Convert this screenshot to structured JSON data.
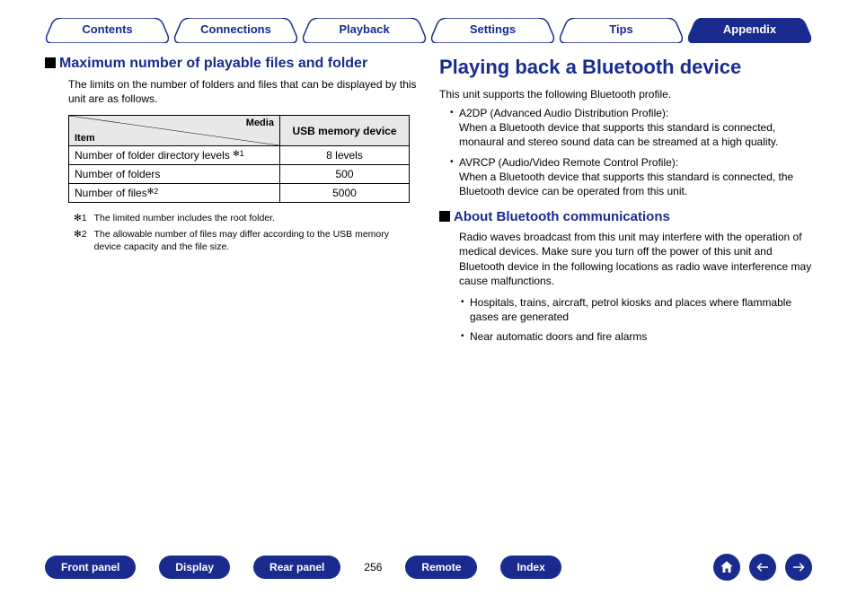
{
  "tabs": {
    "contents": "Contents",
    "connections": "Connections",
    "playback": "Playback",
    "settings": "Settings",
    "tips": "Tips",
    "appendix": "Appendix"
  },
  "left": {
    "heading": "Maximum number of playable files and folder",
    "intro": "The limits on the number of folders and files that can be displayed by this unit are as follows.",
    "table": {
      "corner_media": "Media",
      "corner_item": "Item",
      "col_usb": "USB memory device",
      "rows": {
        "r1_label": "Number of folder directory levels ",
        "r1_sup": "✻1",
        "r1_val": "8 levels",
        "r2_label": "Number of folders",
        "r2_val": "500",
        "r3_label": "Number of files",
        "r3_sup": "✻2",
        "r3_val": "5000"
      }
    },
    "notes": {
      "n1_marker": "✻1",
      "n1_text": "The limited number includes the root folder.",
      "n2_marker": "✻2",
      "n2_text": "The allowable number of files may differ according to the USB memory device capacity and the file size."
    }
  },
  "right": {
    "title": "Playing back a Bluetooth device",
    "intro": "This unit supports the following Bluetooth profile.",
    "bul1_a": "A2DP (Advanced Audio Distribution Profile):",
    "bul1_b": "When a Bluetooth device that supports this standard is connected, monaural and stereo sound data can be streamed at a high quality.",
    "bul2_a": "AVRCP (Audio/Video Remote Control Profile):",
    "bul2_b": "When a Bluetooth device that supports this standard is connected, the Bluetooth device can be operated from this unit.",
    "sub_heading": "About Bluetooth communications",
    "sub_body": "Radio waves broadcast from this unit may interfere with the operation of medical devices. Make sure you turn off the power of this unit and Bluetooth device in the following locations as radio wave interference may cause malfunctions.",
    "sub_li1": "Hospitals, trains, aircraft, petrol kiosks and places where flammable gases are generated",
    "sub_li2": "Near automatic doors and fire alarms"
  },
  "footer": {
    "front": "Front panel",
    "display": "Display",
    "rear": "Rear panel",
    "page": "256",
    "remote": "Remote",
    "index": "Index"
  }
}
